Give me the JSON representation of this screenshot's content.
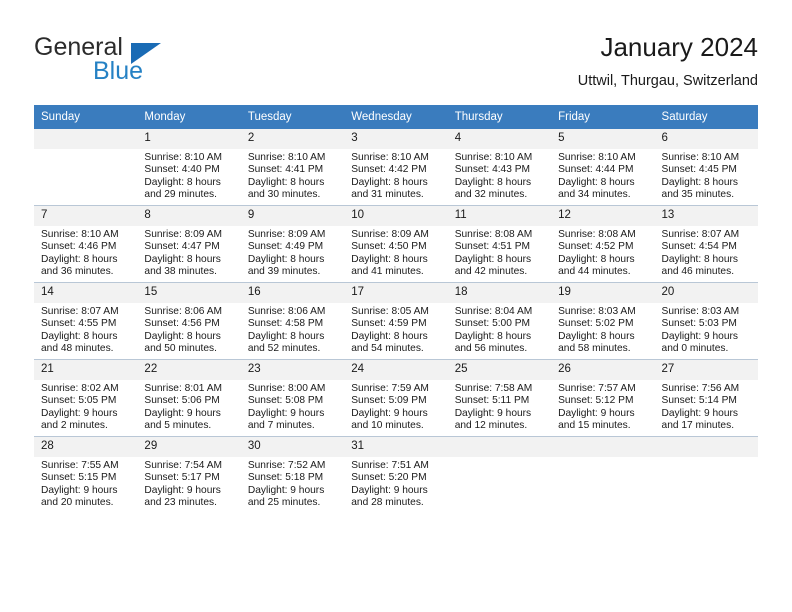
{
  "brand": {
    "name_part1": "General",
    "name_part2": "Blue",
    "accent_color": "#2581c4",
    "triangle_color": "#1a6bb5"
  },
  "header": {
    "title": "January 2024",
    "subtitle": "Uttwil, Thurgau, Switzerland"
  },
  "calendar": {
    "header_bg": "#3a7cbe",
    "daynum_bg": "#f2f2f2",
    "weekdays": [
      "Sunday",
      "Monday",
      "Tuesday",
      "Wednesday",
      "Thursday",
      "Friday",
      "Saturday"
    ],
    "weeks": [
      [
        {
          "day": "",
          "sunrise": "",
          "sunset": "",
          "daylight1": "",
          "daylight2": ""
        },
        {
          "day": "1",
          "sunrise": "Sunrise: 8:10 AM",
          "sunset": "Sunset: 4:40 PM",
          "daylight1": "Daylight: 8 hours",
          "daylight2": "and 29 minutes."
        },
        {
          "day": "2",
          "sunrise": "Sunrise: 8:10 AM",
          "sunset": "Sunset: 4:41 PM",
          "daylight1": "Daylight: 8 hours",
          "daylight2": "and 30 minutes."
        },
        {
          "day": "3",
          "sunrise": "Sunrise: 8:10 AM",
          "sunset": "Sunset: 4:42 PM",
          "daylight1": "Daylight: 8 hours",
          "daylight2": "and 31 minutes."
        },
        {
          "day": "4",
          "sunrise": "Sunrise: 8:10 AM",
          "sunset": "Sunset: 4:43 PM",
          "daylight1": "Daylight: 8 hours",
          "daylight2": "and 32 minutes."
        },
        {
          "day": "5",
          "sunrise": "Sunrise: 8:10 AM",
          "sunset": "Sunset: 4:44 PM",
          "daylight1": "Daylight: 8 hours",
          "daylight2": "and 34 minutes."
        },
        {
          "day": "6",
          "sunrise": "Sunrise: 8:10 AM",
          "sunset": "Sunset: 4:45 PM",
          "daylight1": "Daylight: 8 hours",
          "daylight2": "and 35 minutes."
        }
      ],
      [
        {
          "day": "7",
          "sunrise": "Sunrise: 8:10 AM",
          "sunset": "Sunset: 4:46 PM",
          "daylight1": "Daylight: 8 hours",
          "daylight2": "and 36 minutes."
        },
        {
          "day": "8",
          "sunrise": "Sunrise: 8:09 AM",
          "sunset": "Sunset: 4:47 PM",
          "daylight1": "Daylight: 8 hours",
          "daylight2": "and 38 minutes."
        },
        {
          "day": "9",
          "sunrise": "Sunrise: 8:09 AM",
          "sunset": "Sunset: 4:49 PM",
          "daylight1": "Daylight: 8 hours",
          "daylight2": "and 39 minutes."
        },
        {
          "day": "10",
          "sunrise": "Sunrise: 8:09 AM",
          "sunset": "Sunset: 4:50 PM",
          "daylight1": "Daylight: 8 hours",
          "daylight2": "and 41 minutes."
        },
        {
          "day": "11",
          "sunrise": "Sunrise: 8:08 AM",
          "sunset": "Sunset: 4:51 PM",
          "daylight1": "Daylight: 8 hours",
          "daylight2": "and 42 minutes."
        },
        {
          "day": "12",
          "sunrise": "Sunrise: 8:08 AM",
          "sunset": "Sunset: 4:52 PM",
          "daylight1": "Daylight: 8 hours",
          "daylight2": "and 44 minutes."
        },
        {
          "day": "13",
          "sunrise": "Sunrise: 8:07 AM",
          "sunset": "Sunset: 4:54 PM",
          "daylight1": "Daylight: 8 hours",
          "daylight2": "and 46 minutes."
        }
      ],
      [
        {
          "day": "14",
          "sunrise": "Sunrise: 8:07 AM",
          "sunset": "Sunset: 4:55 PM",
          "daylight1": "Daylight: 8 hours",
          "daylight2": "and 48 minutes."
        },
        {
          "day": "15",
          "sunrise": "Sunrise: 8:06 AM",
          "sunset": "Sunset: 4:56 PM",
          "daylight1": "Daylight: 8 hours",
          "daylight2": "and 50 minutes."
        },
        {
          "day": "16",
          "sunrise": "Sunrise: 8:06 AM",
          "sunset": "Sunset: 4:58 PM",
          "daylight1": "Daylight: 8 hours",
          "daylight2": "and 52 minutes."
        },
        {
          "day": "17",
          "sunrise": "Sunrise: 8:05 AM",
          "sunset": "Sunset: 4:59 PM",
          "daylight1": "Daylight: 8 hours",
          "daylight2": "and 54 minutes."
        },
        {
          "day": "18",
          "sunrise": "Sunrise: 8:04 AM",
          "sunset": "Sunset: 5:00 PM",
          "daylight1": "Daylight: 8 hours",
          "daylight2": "and 56 minutes."
        },
        {
          "day": "19",
          "sunrise": "Sunrise: 8:03 AM",
          "sunset": "Sunset: 5:02 PM",
          "daylight1": "Daylight: 8 hours",
          "daylight2": "and 58 minutes."
        },
        {
          "day": "20",
          "sunrise": "Sunrise: 8:03 AM",
          "sunset": "Sunset: 5:03 PM",
          "daylight1": "Daylight: 9 hours",
          "daylight2": "and 0 minutes."
        }
      ],
      [
        {
          "day": "21",
          "sunrise": "Sunrise: 8:02 AM",
          "sunset": "Sunset: 5:05 PM",
          "daylight1": "Daylight: 9 hours",
          "daylight2": "and 2 minutes."
        },
        {
          "day": "22",
          "sunrise": "Sunrise: 8:01 AM",
          "sunset": "Sunset: 5:06 PM",
          "daylight1": "Daylight: 9 hours",
          "daylight2": "and 5 minutes."
        },
        {
          "day": "23",
          "sunrise": "Sunrise: 8:00 AM",
          "sunset": "Sunset: 5:08 PM",
          "daylight1": "Daylight: 9 hours",
          "daylight2": "and 7 minutes."
        },
        {
          "day": "24",
          "sunrise": "Sunrise: 7:59 AM",
          "sunset": "Sunset: 5:09 PM",
          "daylight1": "Daylight: 9 hours",
          "daylight2": "and 10 minutes."
        },
        {
          "day": "25",
          "sunrise": "Sunrise: 7:58 AM",
          "sunset": "Sunset: 5:11 PM",
          "daylight1": "Daylight: 9 hours",
          "daylight2": "and 12 minutes."
        },
        {
          "day": "26",
          "sunrise": "Sunrise: 7:57 AM",
          "sunset": "Sunset: 5:12 PM",
          "daylight1": "Daylight: 9 hours",
          "daylight2": "and 15 minutes."
        },
        {
          "day": "27",
          "sunrise": "Sunrise: 7:56 AM",
          "sunset": "Sunset: 5:14 PM",
          "daylight1": "Daylight: 9 hours",
          "daylight2": "and 17 minutes."
        }
      ],
      [
        {
          "day": "28",
          "sunrise": "Sunrise: 7:55 AM",
          "sunset": "Sunset: 5:15 PM",
          "daylight1": "Daylight: 9 hours",
          "daylight2": "and 20 minutes."
        },
        {
          "day": "29",
          "sunrise": "Sunrise: 7:54 AM",
          "sunset": "Sunset: 5:17 PM",
          "daylight1": "Daylight: 9 hours",
          "daylight2": "and 23 minutes."
        },
        {
          "day": "30",
          "sunrise": "Sunrise: 7:52 AM",
          "sunset": "Sunset: 5:18 PM",
          "daylight1": "Daylight: 9 hours",
          "daylight2": "and 25 minutes."
        },
        {
          "day": "31",
          "sunrise": "Sunrise: 7:51 AM",
          "sunset": "Sunset: 5:20 PM",
          "daylight1": "Daylight: 9 hours",
          "daylight2": "and 28 minutes."
        },
        {
          "day": "",
          "sunrise": "",
          "sunset": "",
          "daylight1": "",
          "daylight2": ""
        },
        {
          "day": "",
          "sunrise": "",
          "sunset": "",
          "daylight1": "",
          "daylight2": ""
        },
        {
          "day": "",
          "sunrise": "",
          "sunset": "",
          "daylight1": "",
          "daylight2": ""
        }
      ]
    ]
  }
}
